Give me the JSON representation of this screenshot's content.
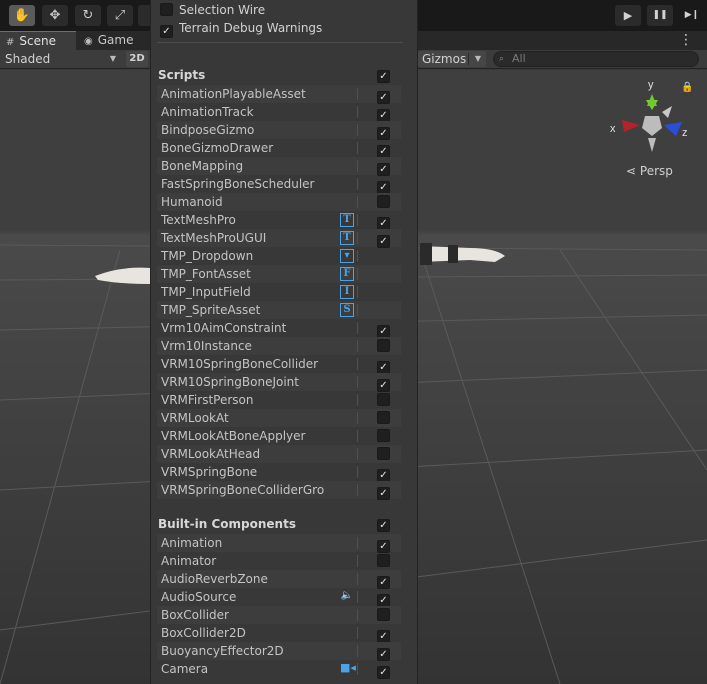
{
  "toolbar": {
    "tools": [
      {
        "icon": "hand-tool-icon",
        "glyph": "✋"
      },
      {
        "icon": "move-tool-icon",
        "glyph": "✥"
      },
      {
        "icon": "rotate-tool-icon",
        "glyph": "↻"
      },
      {
        "icon": "scale-tool-icon",
        "glyph": "⤢"
      }
    ],
    "play_glyph": "▶",
    "pause_glyph": "❚❚",
    "step_glyph": "▶❙"
  },
  "tabs": [
    {
      "label": "Scene",
      "icon": "scene-grid-icon",
      "glyph": "#"
    },
    {
      "label": "Game",
      "icon": "game-controller-icon",
      "glyph": "◉"
    }
  ],
  "kebab_glyph": "⋮",
  "scene_bar": {
    "shading_mode": "Shaded",
    "mode_2d": "2D",
    "gizmos_label": "Gizmos",
    "search_placeholder": "All",
    "search_glyph": "⌕",
    "arrow_glyph": "▼"
  },
  "viewport": {
    "axis_x": "x",
    "axis_y": "y",
    "axis_z": "z",
    "persp_label": "Persp",
    "persp_glyph": "⋖",
    "lock_glyph": "🔒"
  },
  "panel": {
    "options": [
      {
        "label": "Selection Wire",
        "checked": false
      },
      {
        "label": "Terrain Debug Warnings",
        "checked": true
      }
    ],
    "check_glyph": "✓",
    "scroll_up_glyph": "▲",
    "scroll_down_glyph": "▼",
    "scripts": {
      "header": "Scripts",
      "checked": true,
      "items": [
        {
          "name": "AnimationPlayableAsset",
          "checked": true,
          "icon": null
        },
        {
          "name": "AnimationTrack",
          "checked": true,
          "icon": null
        },
        {
          "name": "BindposeGizmo",
          "checked": true,
          "icon": null
        },
        {
          "name": "BoneGizmoDrawer",
          "checked": true,
          "icon": null
        },
        {
          "name": "BoneMapping",
          "checked": true,
          "icon": null
        },
        {
          "name": "FastSpringBoneScheduler",
          "checked": true,
          "icon": null
        },
        {
          "name": "Humanoid",
          "checked": false,
          "icon": null
        },
        {
          "name": "TextMeshPro",
          "checked": true,
          "icon": {
            "name": "textmeshpro-icon",
            "glyph": "T"
          }
        },
        {
          "name": "TextMeshProUGUI",
          "checked": true,
          "icon": {
            "name": "textmeshpro-ugui-icon",
            "glyph": "T"
          }
        },
        {
          "name": "TMP_Dropdown",
          "checked": null,
          "icon": {
            "name": "tmp-dropdown-icon",
            "glyph": "▾"
          }
        },
        {
          "name": "TMP_FontAsset",
          "checked": null,
          "icon": {
            "name": "tmp-font-asset-icon",
            "glyph": "F"
          }
        },
        {
          "name": "TMP_InputField",
          "checked": null,
          "icon": {
            "name": "tmp-input-field-icon",
            "glyph": "I"
          }
        },
        {
          "name": "TMP_SpriteAsset",
          "checked": null,
          "icon": {
            "name": "tmp-sprite-asset-icon",
            "glyph": "S"
          }
        },
        {
          "name": "Vrm10AimConstraint",
          "checked": true,
          "icon": null
        },
        {
          "name": "Vrm10Instance",
          "checked": false,
          "icon": null
        },
        {
          "name": "VRM10SpringBoneCollider",
          "checked": true,
          "icon": null
        },
        {
          "name": "VRM10SpringBoneJoint",
          "checked": true,
          "icon": null
        },
        {
          "name": "VRMFirstPerson",
          "checked": false,
          "icon": null
        },
        {
          "name": "VRMLookAt",
          "checked": false,
          "icon": null
        },
        {
          "name": "VRMLookAtBoneApplyer",
          "checked": false,
          "icon": null
        },
        {
          "name": "VRMLookAtHead",
          "checked": false,
          "icon": null
        },
        {
          "name": "VRMSpringBone",
          "checked": true,
          "icon": null
        },
        {
          "name": "VRMSpringBoneColliderGro",
          "checked": true,
          "icon": null
        }
      ]
    },
    "builtin": {
      "header": "Built-in Components",
      "checked": true,
      "items": [
        {
          "name": "Animation",
          "checked": true,
          "icon": null
        },
        {
          "name": "Animator",
          "checked": false,
          "icon": null
        },
        {
          "name": "AudioReverbZone",
          "checked": true,
          "icon": null
        },
        {
          "name": "AudioSource",
          "checked": true,
          "icon": {
            "name": "speaker-icon",
            "glyph": "🔈"
          }
        },
        {
          "name": "BoxCollider",
          "checked": false,
          "icon": null
        },
        {
          "name": "BoxCollider2D",
          "checked": true,
          "icon": null
        },
        {
          "name": "BuoyancyEffector2D",
          "checked": true,
          "icon": null
        },
        {
          "name": "Camera",
          "checked": true,
          "icon": {
            "name": "camera-icon",
            "glyph": "■◂"
          }
        }
      ]
    }
  }
}
